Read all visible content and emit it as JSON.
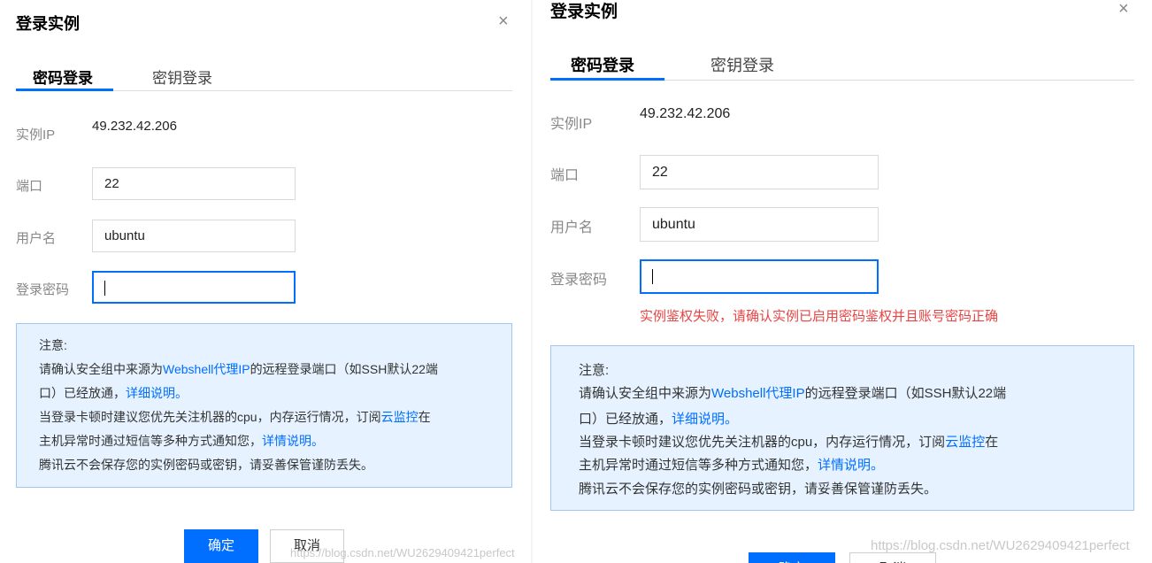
{
  "left": {
    "title": "登录实例",
    "close": "×",
    "tabs": {
      "password": "密码登录",
      "key": "密钥登录"
    },
    "ip": {
      "label": "实例IP",
      "value": "49.232.42.206"
    },
    "port": {
      "label": "端口",
      "value": "22"
    },
    "username": {
      "label": "用户名",
      "value": "ubuntu"
    },
    "password": {
      "label": "登录密码",
      "value": ""
    },
    "notice": {
      "heading": "注意:",
      "l1a": "请确认安全组中来源为",
      "l1b": "Webshell代理IP",
      "l1c": "的远程登录端口（如SSH默认22端",
      "l2a": "口）已经放通，",
      "l2b": "详细说明。",
      "l3a": "当登录卡顿时建议您优先关注机器的cpu，内存运行情况，订阅",
      "l3b": "云监控",
      "l3c": "在",
      "l4a": "主机异常时通过短信等多种方式通知您，",
      "l4b": "详情说明。",
      "l5": "腾讯云不会保存您的实例密码或密钥，请妥善保管谨防丢失。"
    },
    "buttons": {
      "ok": "确定",
      "cancel": "取消"
    },
    "watermark": "https://blog.csdn.net/WU2629409421perfect"
  },
  "right": {
    "title": "登录实例",
    "close": "×",
    "tabs": {
      "password": "密码登录",
      "key": "密钥登录"
    },
    "ip": {
      "label": "实例IP",
      "value": "49.232.42.206"
    },
    "port": {
      "label": "端口",
      "value": "22"
    },
    "username": {
      "label": "用户名",
      "value": "ubuntu"
    },
    "password": {
      "label": "登录密码",
      "value": ""
    },
    "error": "实例鉴权失败，请确认实例已启用密码鉴权并且账号密码正确",
    "notice": {
      "heading": "注意:",
      "l1a": "请确认安全组中来源为",
      "l1b": "Webshell代理IP",
      "l1c": "的远程登录端口（如SSH默认22端",
      "l2a": "口）已经放通，",
      "l2b": "详细说明。",
      "l3a": "当登录卡顿时建议您优先关注机器的cpu，内存运行情况，订阅",
      "l3b": "云监控",
      "l3c": "在",
      "l4a": "主机异常时通过短信等多种方式通知您，",
      "l4b": "详情说明。",
      "l5": "腾讯云不会保存您的实例密码或密钥，请妥善保管谨防丢失。"
    },
    "buttons": {
      "ok": "确定",
      "cancel": "取消"
    },
    "watermark": "https://blog.csdn.net/WU2629409421perfect"
  },
  "colors": {
    "accent": "#006eff",
    "error": "#e54545",
    "notice_bg": "#e6f2ff",
    "notice_border": "#9fc7ef"
  }
}
